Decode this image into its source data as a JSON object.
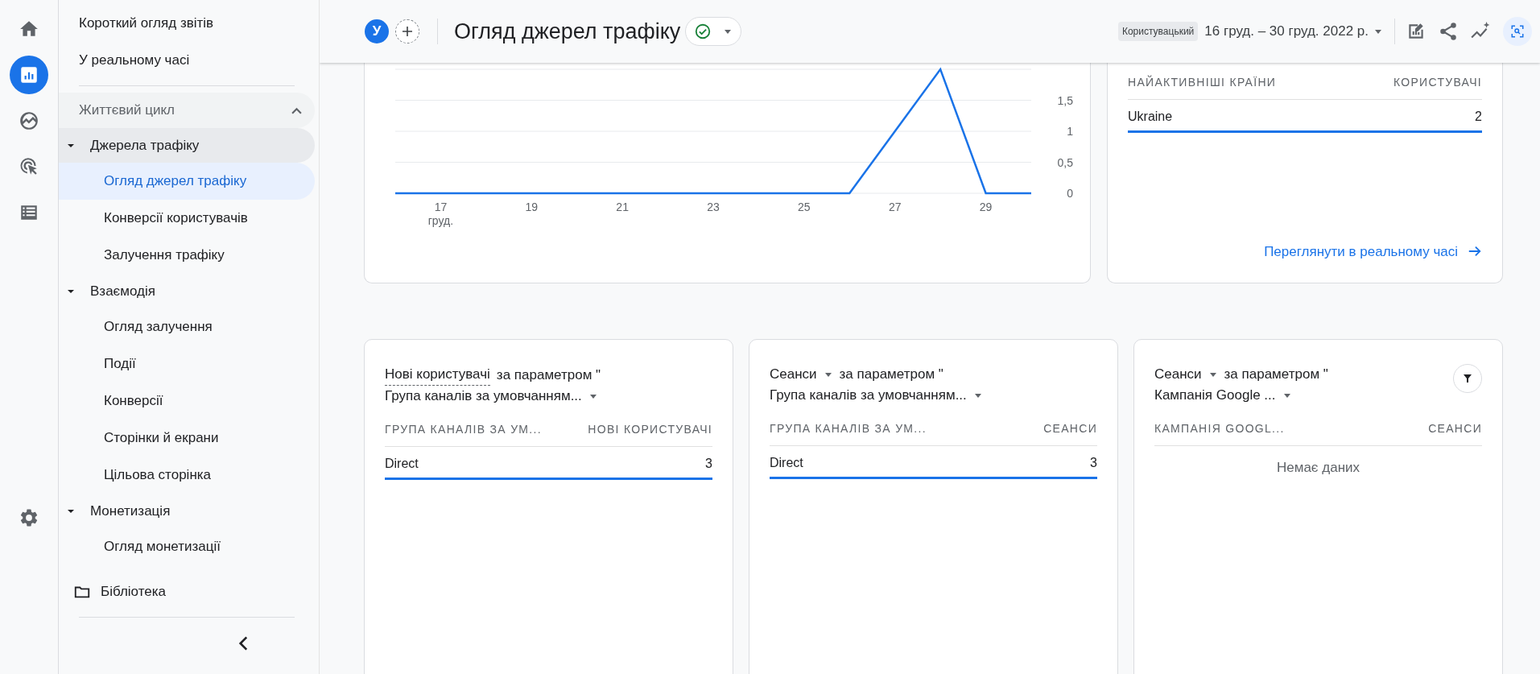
{
  "rail": {
    "items": [
      {
        "kind": "home",
        "selected": false
      },
      {
        "kind": "reports",
        "selected": true
      },
      {
        "kind": "explore",
        "selected": false
      },
      {
        "kind": "advertising",
        "selected": false
      },
      {
        "kind": "configure",
        "selected": false
      }
    ]
  },
  "sidebar": {
    "top_items": [
      {
        "label": "Короткий огляд звітів",
        "selected": false
      },
      {
        "label": "У реальному часі",
        "selected": false
      }
    ],
    "section": {
      "label": "Життєвий цикл",
      "expanded": true,
      "groups": [
        {
          "label": "Джерела трафіку",
          "expanded": true,
          "highlighted": true,
          "children": [
            {
              "label": "Огляд джерел трафіку",
              "selected": true
            },
            {
              "label": "Конверсії користувачів",
              "selected": false
            },
            {
              "label": "Залучення трафіку",
              "selected": false
            }
          ]
        },
        {
          "label": "Взаємодія",
          "expanded": true,
          "highlighted": false,
          "children": [
            {
              "label": "Огляд залучення",
              "selected": false
            },
            {
              "label": "Події",
              "selected": false
            },
            {
              "label": "Конверсії",
              "selected": false
            },
            {
              "label": "Сторінки й екрани",
              "selected": false
            },
            {
              "label": "Цільова сторінка",
              "selected": false
            }
          ]
        },
        {
          "label": "Монетизація",
          "expanded": true,
          "highlighted": false,
          "children": [
            {
              "label": "Огляд монетизації",
              "selected": false
            }
          ]
        }
      ]
    },
    "library": "Бібліотека"
  },
  "header": {
    "avatar": "У",
    "title": "Огляд джерел трафіку",
    "comparison": "Користувацький",
    "date_range": "16 груд. – 30 груд. 2022 р."
  },
  "chart_card": {
    "chart_data": {
      "type": "line",
      "x": [
        16,
        17,
        18,
        19,
        20,
        21,
        22,
        23,
        24,
        25,
        26,
        27,
        28,
        29,
        30
      ],
      "series": [
        {
          "color": "#1a73e8",
          "values": [
            0,
            0,
            0,
            0,
            0,
            0,
            0,
            0,
            0,
            0,
            0,
            1,
            2,
            0,
            0
          ]
        }
      ],
      "xticks": [
        {
          "value": 17,
          "label": "17 груд."
        },
        {
          "value": 19,
          "label": "19"
        },
        {
          "value": 21,
          "label": "21"
        },
        {
          "value": 23,
          "label": "23"
        },
        {
          "value": 25,
          "label": "25"
        },
        {
          "value": 27,
          "label": "27"
        },
        {
          "value": 29,
          "label": "29"
        }
      ],
      "yticks": [
        {
          "value": 0,
          "label": "0"
        },
        {
          "value": 0.5,
          "label": "0,5"
        },
        {
          "value": 1,
          "label": "1"
        },
        {
          "value": 1.5,
          "label": "1,5"
        }
      ],
      "xlim": [
        16,
        30
      ],
      "ylim": [
        0,
        2
      ],
      "grid": true
    }
  },
  "country_card": {
    "columns": [
      "НАЙАКТИВНІШІ КРАЇНИ",
      "КОРИСТУВАЧІ"
    ],
    "rows": [
      {
        "name": "Ukraine",
        "value": "2",
        "level": 1
      }
    ],
    "link": "Переглянути в реальному часі"
  },
  "cards": [
    {
      "metric": "Нові користувачі",
      "metric_dropdown": false,
      "param": "за параметром \"",
      "dimension": "Група каналів за умовчанням...",
      "filter": false,
      "columns": [
        "ГРУПА КАНАЛІВ ЗА УМ...",
        "НОВІ КОРИСТУВАЧІ"
      ],
      "rows": [
        {
          "name": "Direct",
          "value": "3",
          "level": 1
        }
      ]
    },
    {
      "metric": "Сеанси",
      "metric_dropdown": true,
      "param": "за параметром \"",
      "dimension": "Група каналів за умовчанням...",
      "filter": false,
      "columns": [
        "ГРУПА КАНАЛІВ ЗА УМ...",
        "СЕАНСИ"
      ],
      "rows": [
        {
          "name": "Direct",
          "value": "3",
          "level": 1
        }
      ]
    },
    {
      "metric": "Сеанси",
      "metric_dropdown": true,
      "param": "за параметром \"",
      "dimension": "Кампанія Google ...",
      "filter": true,
      "columns": [
        "КАМПАНІЯ GOOGL...",
        "СЕАНСИ"
      ],
      "empty_text": "Немає даних"
    }
  ]
}
